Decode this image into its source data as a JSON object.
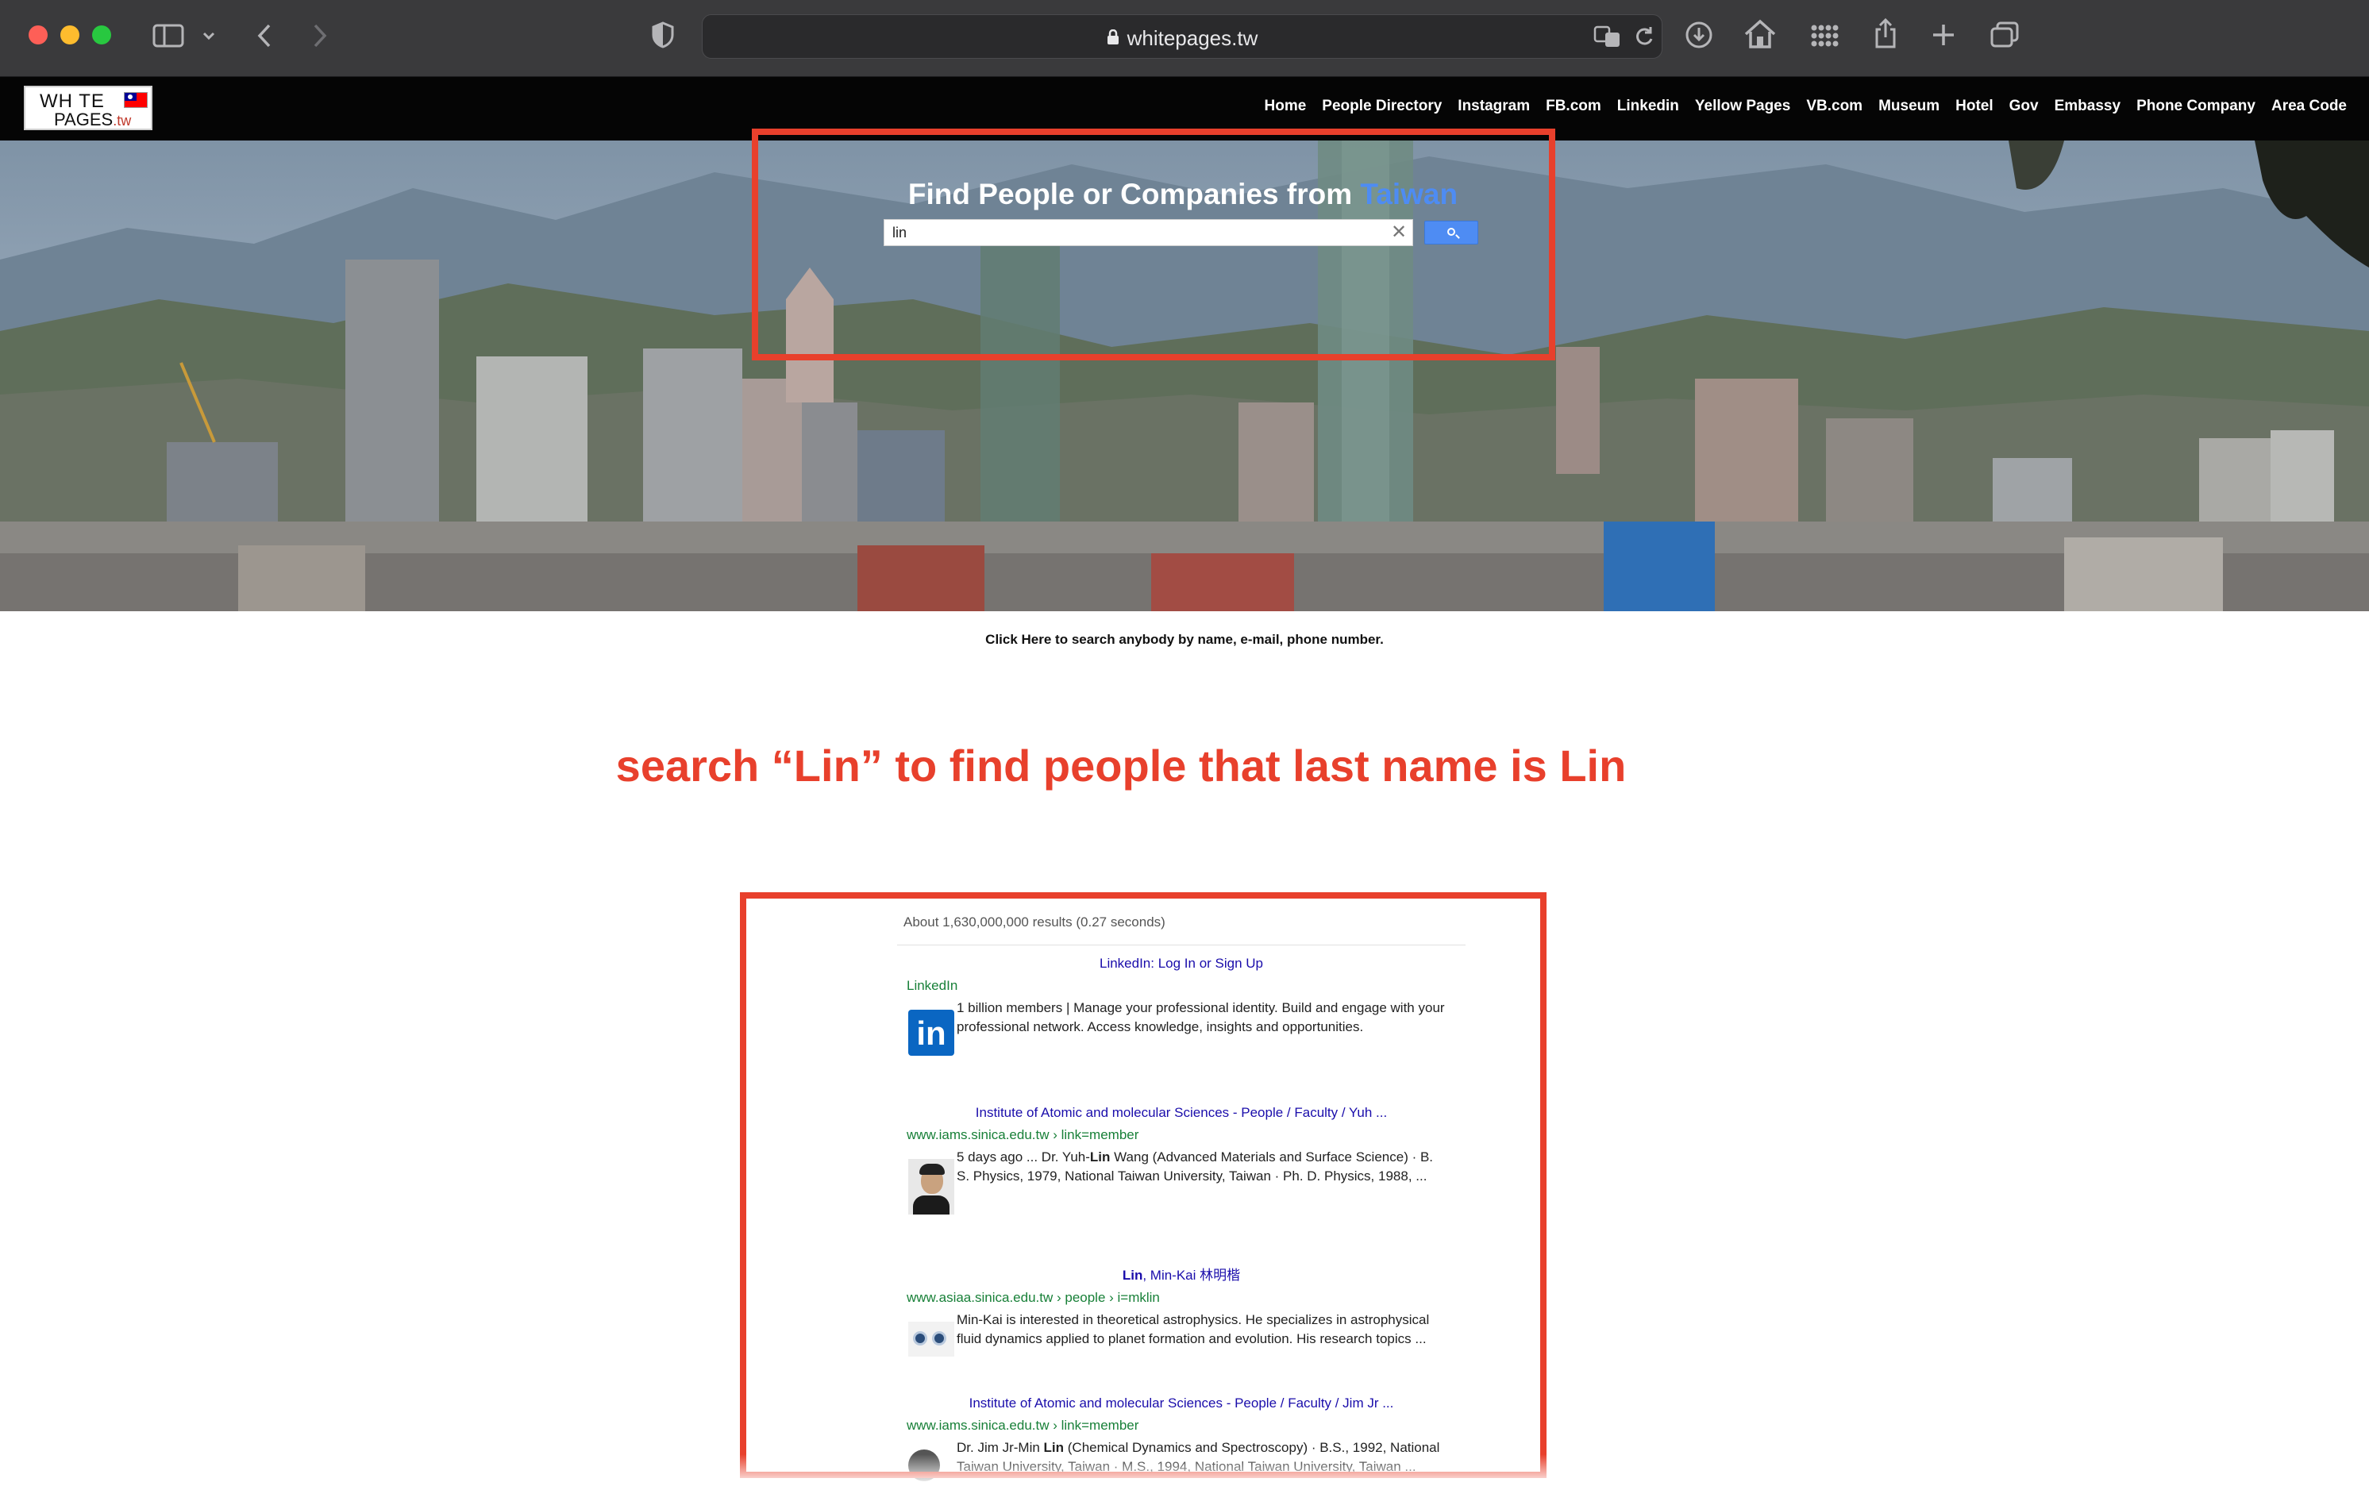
{
  "browser": {
    "url": "whitepages.tw"
  },
  "site": {
    "logo": {
      "line1": "WH TE",
      "line2": "PAGES",
      "suffix": ".tw"
    },
    "nav": [
      "Home",
      "People Directory",
      "Instagram",
      "FB.com",
      "Linkedin",
      "Yellow Pages",
      "VB.com",
      "Museum",
      "Hotel",
      "Gov",
      "Embassy",
      "Phone Company",
      "Area Code"
    ]
  },
  "hero": {
    "title": "Find People or Companies from",
    "title_highlight": "Taiwan",
    "search_value": "lin"
  },
  "click_here": "Click Here to search anybody by name, e-mail, phone number.",
  "annotation": "search “Lin” to find people that last name is Lin",
  "results": {
    "stats": "About 1,630,000,000 results (0.27 seconds)",
    "items": [
      {
        "title": "LinkedIn: Log In or Sign Up",
        "url": "LinkedIn",
        "snippet": "1 billion members | Manage your professional identity. Build and engage with your professional network. Access knowledge, insights and opportunities."
      },
      {
        "title": "Institute of Atomic and molecular Sciences - People / Faculty / Yuh ...",
        "url": "www.iams.sinica.edu.tw › link=member",
        "snippet_pre": "5 days ago ... Dr. Yuh-",
        "snippet_bold": "Lin",
        "snippet_post": " Wang (Advanced Materials and Surface Science) · B. S. Physics, 1979, National Taiwan University, Taiwan · Ph. D. Physics, 1988, ..."
      },
      {
        "title_bold": "Lin",
        "title_rest": ", Min-Kai 林明楷",
        "url": "www.asiaa.sinica.edu.tw › people › i=mklin",
        "snippet": "Min-Kai is interested in theoretical astrophysics. He specializes in astrophysical fluid dynamics applied to planet formation and evolution. His research topics ..."
      },
      {
        "title": "Institute of Atomic and molecular Sciences - People / Faculty / Jim Jr ...",
        "url": "www.iams.sinica.edu.tw › link=member",
        "snippet_pre": "Dr. Jim Jr-Min ",
        "snippet_bold": "Lin",
        "snippet_post": " (Chemical Dynamics and Spectroscopy) · B.S., 1992, National Taiwan University, Taiwan · M.S., 1994, National Taiwan University, Taiwan ..."
      }
    ]
  },
  "colors": {
    "annotation_red": "#e8402c",
    "link_blue": "#1a0dab",
    "url_green": "#188038",
    "accent_blue": "#4e8cf3"
  }
}
